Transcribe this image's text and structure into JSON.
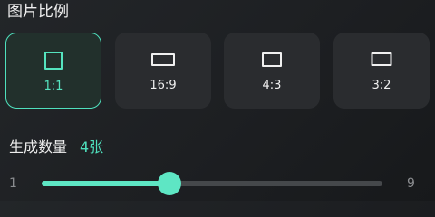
{
  "aspect": {
    "title": "图片比例",
    "selected": "1:1",
    "options": [
      {
        "label": "1:1",
        "icon": "square-icon"
      },
      {
        "label": "16:9",
        "icon": "wide-rectangle-icon"
      },
      {
        "label": "4:3",
        "icon": "landscape-rectangle-icon"
      },
      {
        "label": "3:2",
        "icon": "landscape-rectangle-icon"
      }
    ]
  },
  "count": {
    "title": "生成数量",
    "value_text": "4张",
    "min": "1",
    "max": "9",
    "value": 4,
    "fill_fraction": 0.375
  },
  "colors": {
    "accent": "#4fe0bd",
    "card": "#2a2c2f",
    "track": "#45484b"
  }
}
